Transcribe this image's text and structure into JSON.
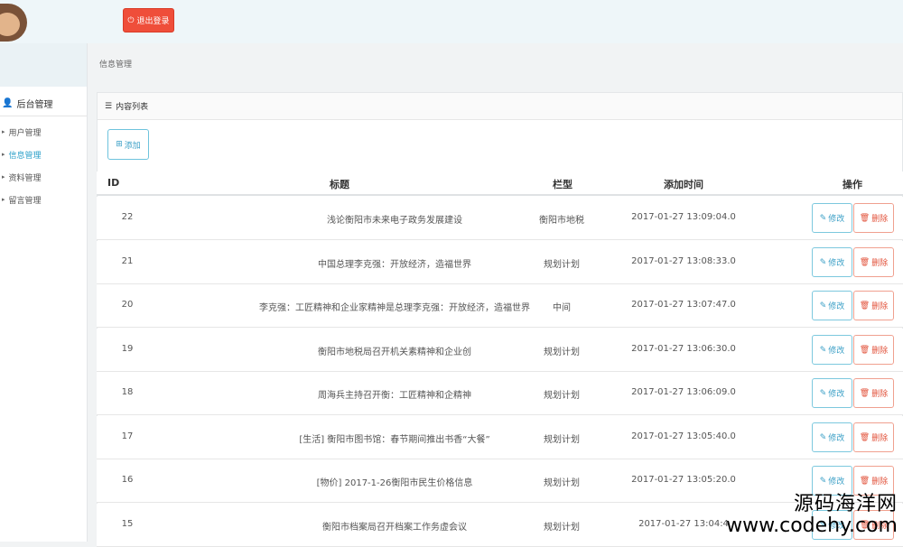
{
  "header": {
    "logout_label": "退出登录"
  },
  "sidebar": {
    "title": "后台管理",
    "items": [
      {
        "label": "用户管理",
        "active": false
      },
      {
        "label": "信息管理",
        "active": true
      },
      {
        "label": "资料管理",
        "active": false
      },
      {
        "label": "留言管理",
        "active": false
      }
    ]
  },
  "breadcrumb": "信息管理",
  "panel": {
    "title": "内容列表",
    "add_label": "添加"
  },
  "table": {
    "columns": {
      "id": "ID",
      "title": "标题",
      "type": "栏型",
      "time": "添加时间",
      "actions": "操作"
    },
    "edit_label": "修改",
    "delete_label": "删除",
    "rows": [
      {
        "id": "22",
        "title": "浅论衡阳市未来电子政务发展建设",
        "type": "衡阳市地税",
        "time": "2017-01-27 13:09:04.0"
      },
      {
        "id": "21",
        "title": "中国总理李克强：开放经济，造福世界",
        "type": "规划计划",
        "time": "2017-01-27 13:08:33.0"
      },
      {
        "id": "20",
        "title": "李克强：工匠精神和企业家精神是总理李克强：开放经济，造福世界",
        "type": "中间",
        "time": "2017-01-27 13:07:47.0"
      },
      {
        "id": "19",
        "title": "衡阳市地税局召开机关素精神和企业创",
        "type": "规划计划",
        "time": "2017-01-27 13:06:30.0"
      },
      {
        "id": "18",
        "title": "周海兵主持召开衡：工匠精神和企精神",
        "type": "规划计划",
        "time": "2017-01-27 13:06:09.0"
      },
      {
        "id": "17",
        "title": "[生活] 衡阳市图书馆：春节期间推出书香“大餐”",
        "type": "规划计划",
        "time": "2017-01-27 13:05:40.0"
      },
      {
        "id": "16",
        "title": "[物价] 2017-1-26衡阳市民生价格信息",
        "type": "规划计划",
        "time": "2017-01-27 13:05:20.0"
      },
      {
        "id": "15",
        "title": "衡阳市档案局召开档案工作务虚会议",
        "type": "规划计划",
        "time": "2017-01-27 13:04:4"
      }
    ]
  },
  "watermark": {
    "line1": "源码海洋网",
    "line2": "www.codehy.com"
  }
}
